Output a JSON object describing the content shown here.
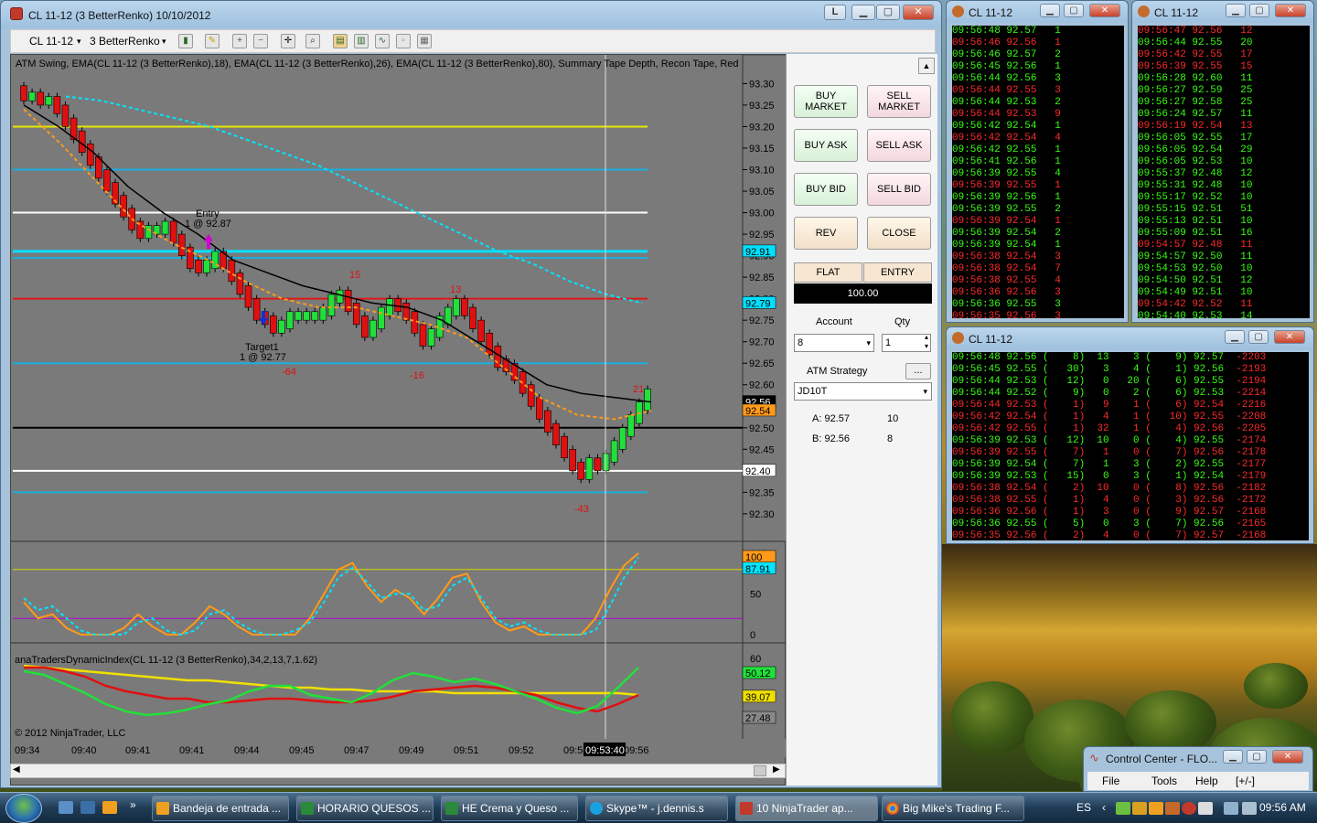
{
  "main_window": {
    "title": "CL 11-12 (3 BetterRenko)  10/10/2012",
    "link_button": "L",
    "min": "▁",
    "max": "▢",
    "close": "✕"
  },
  "toolbar": {
    "instrument": "CL 11-12",
    "period": "3 BetterRenko",
    "dropdown_arrow": "▾"
  },
  "chart": {
    "indicators": "ATM Swing, EMA(CL 11-12 (3 BetterRenko),18), EMA(CL 11-12 (3 BetterRenko),26), EMA(CL 11-12 (3 BetterRenko),80), Summary Tape Depth, Recon Tape, Red",
    "copyright": "© 2012 NinjaTrader, LLC",
    "tdi_label": "anaTradersDynamicIndex(CL 11-12 (3 BetterRenko),34,2,13,7,1.62)",
    "crosshair_time": "09:53:40",
    "annotations": {
      "entry": "Entry",
      "entry_fill": "1 @ 92.87",
      "target": "Target1",
      "target_fill": "1 @ 92.77",
      "swing_15": "15",
      "swing_13": "13",
      "swing_21": "21",
      "swing_m64": "-64",
      "swing_m16": "-16",
      "swing_m43": "-43"
    },
    "price_labels": {
      "p9291": "92.91",
      "p9279": "92.79",
      "p9256": "92.56",
      "p9254": "92.54",
      "p9240": "92.40",
      "osc100": "100",
      "osc8791": "87.91",
      "tdi_top": "50.12",
      "tdi_mid": "39.07",
      "tdi_low": "27.48"
    }
  },
  "chart_data": {
    "type": "line",
    "title": "",
    "price_axis": [
      "93.30",
      "93.25",
      "93.20",
      "93.15",
      "93.10",
      "93.05",
      "93.00",
      "92.95",
      "92.90",
      "92.85",
      "92.80",
      "92.75",
      "92.70",
      "92.65",
      "92.60",
      "92.55",
      "92.50",
      "92.45",
      "92.40",
      "92.35",
      "92.30"
    ],
    "osc_axis": [
      "100",
      "50",
      "0"
    ],
    "tdi_axis": [
      "60"
    ],
    "time_axis": [
      "09:34",
      "09:40",
      "09:41",
      "09:41",
      "09:44",
      "09:45",
      "09:47",
      "09:49",
      "09:51",
      "09:52",
      "09:53",
      "09:56"
    ],
    "ylim": [
      92.27,
      93.32
    ],
    "horizontal_lines": [
      {
        "price": 93.2,
        "color": "#e8e800"
      },
      {
        "price": 93.1,
        "color": "#1ab0e0"
      },
      {
        "price": 93.0,
        "color": "#ffffff"
      },
      {
        "price": 92.91,
        "color": "#00e0ff"
      },
      {
        "price": 92.895,
        "color": "#1ab0e0"
      },
      {
        "price": 92.8,
        "color": "#e01818"
      },
      {
        "price": 92.65,
        "color": "#1ab0e0"
      },
      {
        "price": 92.5,
        "color": "#000000"
      },
      {
        "price": 92.4,
        "color": "#ffffff"
      },
      {
        "price": 92.35,
        "color": "#1ab0e0"
      }
    ],
    "series": [
      {
        "color": "#00e5ff",
        "values": [
          93.27,
          93.26,
          93.24,
          93.22,
          93.2,
          93.17,
          93.14,
          93.11,
          93.07,
          93.03,
          92.99,
          92.95,
          92.91,
          92.88,
          92.84,
          92.81,
          92.79
        ]
      },
      {
        "color": "#000000",
        "values": [
          93.25,
          93.2,
          93.14,
          93.06,
          93.0,
          92.95,
          92.89,
          92.86,
          92.83,
          92.81,
          92.79,
          92.78,
          92.75,
          92.7,
          92.65,
          92.6,
          92.58,
          92.57,
          92.56
        ]
      },
      {
        "color": "#ff9a1a",
        "values": [
          93.24,
          93.16,
          93.07,
          92.98,
          92.93,
          92.89,
          92.84,
          92.8,
          92.78,
          92.78,
          92.76,
          92.74,
          92.71,
          92.64,
          92.57,
          92.53,
          92.52,
          92.54
        ]
      }
    ],
    "candles": [
      93.27,
      93.27,
      93.26,
      93.26,
      93.24,
      93.21,
      93.18,
      93.15,
      93.12,
      93.09,
      93.06,
      93.03,
      93.0,
      92.97,
      92.95,
      92.96,
      92.96,
      92.97,
      92.94,
      92.91,
      92.88,
      92.87,
      92.88,
      92.9,
      92.88,
      92.85,
      92.82,
      92.79,
      92.76,
      92.75,
      92.73,
      92.74,
      92.76,
      92.76,
      92.76,
      92.76,
      92.77,
      92.8,
      92.81,
      92.78,
      92.75,
      92.72,
      92.74,
      92.77,
      92.79,
      92.78,
      92.76,
      92.73,
      92.7,
      92.72,
      92.75,
      92.77,
      92.79,
      92.77,
      92.74,
      92.71,
      92.68,
      92.65,
      92.64,
      92.62,
      92.59,
      92.56,
      92.53,
      92.5,
      92.47,
      92.44,
      92.41,
      92.39,
      92.42,
      92.41,
      92.43,
      92.46,
      92.49,
      92.52,
      92.55,
      92.58
    ]
  },
  "trader": {
    "buy_market": "BUY\nMARKET",
    "sell_market": "SELL\nMARKET",
    "buy_ask": "BUY ASK",
    "sell_ask": "SELL ASK",
    "buy_bid": "BUY BID",
    "sell_bid": "SELL BID",
    "rev": "REV",
    "close": "CLOSE",
    "position": "FLAT",
    "entry": "ENTRY",
    "pnl": "100.00",
    "account_label": "Account",
    "qty_label": "Qty",
    "account_value": "8",
    "qty_value": "1",
    "atm_label": "ATM Strategy",
    "atm_more": "...",
    "atm_value": "JD10T",
    "ask": "A: 92.57",
    "ask_size": "10",
    "bid": "B: 92.56",
    "bid_size": "8",
    "collapse": "▲"
  },
  "tape1": {
    "title": "CL 11-12",
    "rows": [
      [
        "09:56:48",
        "92.57",
        "1",
        "up"
      ],
      [
        "09:56:46",
        "92.56",
        "1",
        "dn"
      ],
      [
        "09:56:46",
        "92.57",
        "2",
        "up"
      ],
      [
        "09:56:45",
        "92.56",
        "1",
        "up"
      ],
      [
        "09:56:44",
        "92.56",
        "3",
        "up"
      ],
      [
        "09:56:44",
        "92.55",
        "3",
        "dn"
      ],
      [
        "09:56:44",
        "92.53",
        "2",
        "up"
      ],
      [
        "09:56:44",
        "92.53",
        "9",
        "dn"
      ],
      [
        "09:56:42",
        "92.54",
        "1",
        "up"
      ],
      [
        "09:56:42",
        "92.54",
        "4",
        "dn"
      ],
      [
        "09:56:42",
        "92.55",
        "1",
        "up"
      ],
      [
        "09:56:41",
        "92.56",
        "1",
        "up"
      ],
      [
        "09:56:39",
        "92.55",
        "4",
        "up"
      ],
      [
        "09:56:39",
        "92.55",
        "1",
        "dn"
      ],
      [
        "09:56:39",
        "92.56",
        "1",
        "up"
      ],
      [
        "09:56:39",
        "92.55",
        "2",
        "up"
      ],
      [
        "09:56:39",
        "92.54",
        "1",
        "dn"
      ],
      [
        "09:56:39",
        "92.54",
        "2",
        "up"
      ],
      [
        "09:56:39",
        "92.54",
        "1",
        "up"
      ],
      [
        "09:56:38",
        "92.54",
        "3",
        "dn"
      ],
      [
        "09:56:38",
        "92.54",
        "7",
        "dn"
      ],
      [
        "09:56:38",
        "92.55",
        "4",
        "dn"
      ],
      [
        "09:56:36",
        "92.56",
        "3",
        "dn"
      ],
      [
        "09:56:36",
        "92.55",
        "3",
        "up"
      ],
      [
        "09:56:35",
        "92.56",
        "3",
        "dn"
      ]
    ]
  },
  "tape2": {
    "title": "CL 11-12",
    "rows": [
      [
        "09:56:47",
        "92.56",
        "12",
        "dn"
      ],
      [
        "09:56:44",
        "92.55",
        "20",
        "up"
      ],
      [
        "09:56:42",
        "92.55",
        "17",
        "dn"
      ],
      [
        "09:56:39",
        "92.55",
        "15",
        "dn"
      ],
      [
        "09:56:28",
        "92.60",
        "11",
        "up"
      ],
      [
        "09:56:27",
        "92.59",
        "25",
        "up"
      ],
      [
        "09:56:27",
        "92.58",
        "25",
        "up"
      ],
      [
        "09:56:24",
        "92.57",
        "11",
        "up"
      ],
      [
        "09:56:19",
        "92.54",
        "13",
        "dn"
      ],
      [
        "09:56:05",
        "92.55",
        "17",
        "up"
      ],
      [
        "09:56:05",
        "92.54",
        "29",
        "up"
      ],
      [
        "09:56:05",
        "92.53",
        "10",
        "up"
      ],
      [
        "09:55:37",
        "92.48",
        "12",
        "up"
      ],
      [
        "09:55:31",
        "92.48",
        "10",
        "up"
      ],
      [
        "09:55:17",
        "92.52",
        "10",
        "up"
      ],
      [
        "09:55:15",
        "92.51",
        "51",
        "up"
      ],
      [
        "09:55:13",
        "92.51",
        "10",
        "up"
      ],
      [
        "09:55:09",
        "92.51",
        "16",
        "up"
      ],
      [
        "09:54:57",
        "92.48",
        "11",
        "dn"
      ],
      [
        "09:54:57",
        "92.50",
        "11",
        "up"
      ],
      [
        "09:54:53",
        "92.50",
        "10",
        "up"
      ],
      [
        "09:54:50",
        "92.51",
        "12",
        "up"
      ],
      [
        "09:54:49",
        "92.51",
        "10",
        "up"
      ],
      [
        "09:54:42",
        "92.52",
        "11",
        "dn"
      ],
      [
        "09:54:40",
        "92.53",
        "14",
        "up"
      ]
    ]
  },
  "tape3": {
    "title": "CL 11-12",
    "rows": [
      [
        "09:56:48 92.56 (    8)  13    3 (    9) 92.57",
        "-2203",
        "up"
      ],
      [
        "09:56:45 92.55 (   30)   3    4 (    1) 92.56",
        "-2193",
        "up"
      ],
      [
        "09:56:44 92.53 (   12)   0   20 (    6) 92.55",
        "-2194",
        "up"
      ],
      [
        "09:56:44 92.52 (    9)   0    2 (    6) 92.53",
        "-2214",
        "up"
      ],
      [
        "09:56:44 92.53 (    1)   9    1 (    6) 92.54",
        "-2216",
        "dn"
      ],
      [
        "09:56:42 92.54 (    1)   4    1 (   10) 92.55",
        "-2208",
        "dn"
      ],
      [
        "09:56:42 92.55 (    1)  32    1 (    4) 92.56",
        "-2205",
        "dn"
      ],
      [
        "09:56:39 92.53 (   12)  10    0 (    4) 92.55",
        "-2174",
        "up"
      ],
      [
        "09:56:39 92.55 (    7)   1    0 (    7) 92.56",
        "-2178",
        "dn"
      ],
      [
        "09:56:39 92.54 (    7)   1    3 (    2) 92.55",
        "-2177",
        "up"
      ],
      [
        "09:56:39 92.53 (   15)   0    3 (    1) 92.54",
        "-2179",
        "up"
      ],
      [
        "09:56:38 92.54 (    2)  10    0 (    8) 92.56",
        "-2182",
        "dn"
      ],
      [
        "09:56:38 92.55 (    1)   4    0 (    3) 92.56",
        "-2172",
        "dn"
      ],
      [
        "09:56:36 92.56 (    1)   3    0 (    9) 92.57",
        "-2168",
        "dn"
      ],
      [
        "09:56:36 92.55 (    5)   0    3 (    7) 92.56",
        "-2165",
        "up"
      ],
      [
        "09:56:35 92.56 (    2)   4    0 (    7) 92.57",
        "-2168",
        "dn"
      ]
    ]
  },
  "control_center": {
    "title": "Control Center - FLO...",
    "menu": [
      "File",
      "Tools",
      "Help",
      "[+/-]"
    ]
  },
  "taskbar": {
    "tasks": [
      "Bandeja de entrada ...",
      "HORARIO QUESOS ...",
      "HE Crema y Queso ...",
      "Skype™ - j.dennis.s",
      "10 NinjaTrader ap...",
      "Big Mike's Trading F..."
    ],
    "lang": "ES",
    "clock": "09:56 AM",
    "more": "»"
  }
}
